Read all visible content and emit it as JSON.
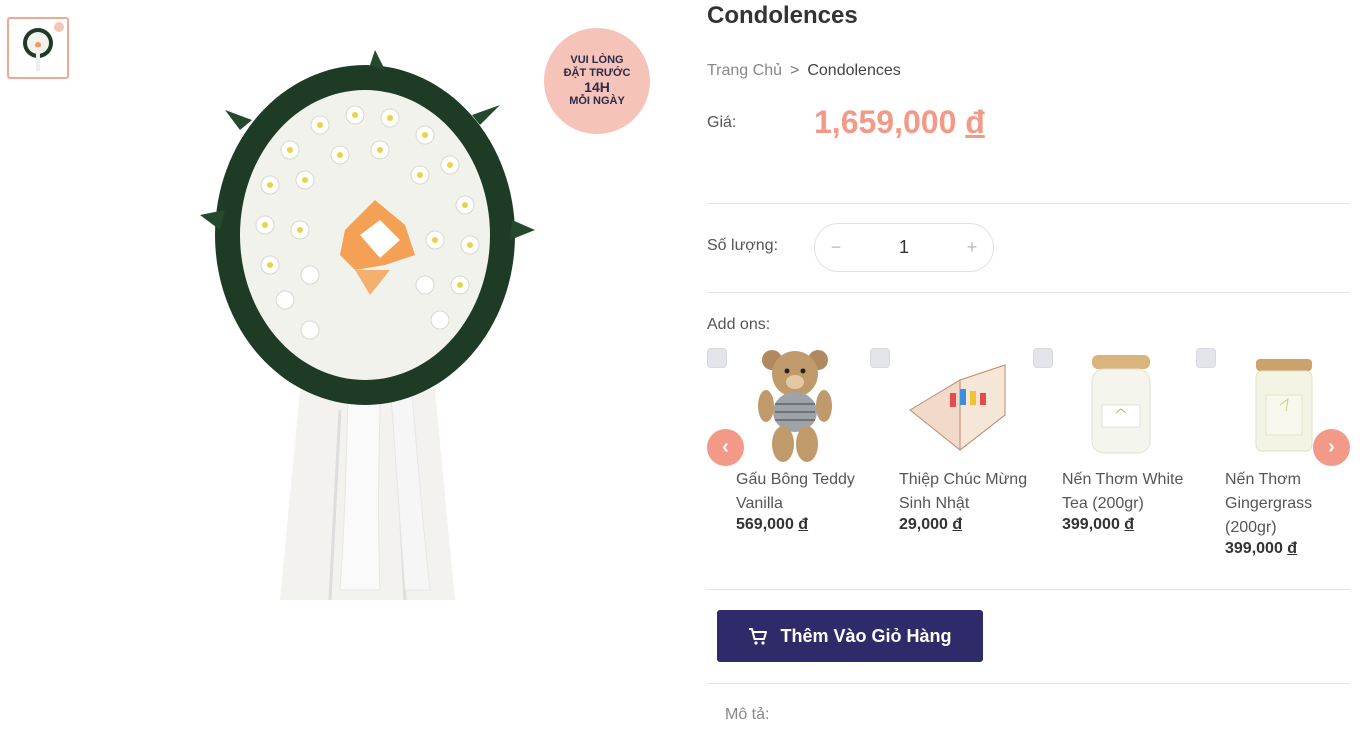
{
  "product": {
    "title": "Condolences",
    "price_label": "Giá:",
    "price": "1,659,000",
    "currency": "đ",
    "badge": {
      "line1": "VUI LÒNG",
      "line2": "ĐẶT TRƯỚC",
      "line3": "14H",
      "line4": "MỖI NGÀY"
    }
  },
  "breadcrumb": {
    "home": "Trang Chủ",
    "separator": ">",
    "current": "Condolences"
  },
  "quantity": {
    "label": "Số lượng:",
    "minus": "−",
    "value": "1",
    "plus": "+"
  },
  "addons": {
    "label": "Add ons:",
    "items": [
      {
        "name": "Gấu Bông Teddy Vanilla",
        "price": "569,000",
        "currency": "đ",
        "icon": "teddy-bear-icon"
      },
      {
        "name": "Thiệp Chúc Mừng Sinh Nhật",
        "price": "29,000",
        "currency": "đ",
        "icon": "greeting-card-icon"
      },
      {
        "name": "Nến Thơm White Tea (200gr)",
        "price": "399,000",
        "currency": "đ",
        "icon": "candle-icon"
      },
      {
        "name": "Nến Thơm Gingergrass (200gr)",
        "price": "399,000",
        "currency": "đ",
        "icon": "candle-icon"
      }
    ],
    "prev": "‹",
    "next": "›"
  },
  "cart_button": {
    "label": "Thêm Vào Giỏ Hàng",
    "icon": "cart-icon"
  },
  "description_label": "Mô tả:",
  "colors": {
    "accent": "#f29a87",
    "button": "#2f2b6a",
    "badge": "#f6c3b8"
  }
}
